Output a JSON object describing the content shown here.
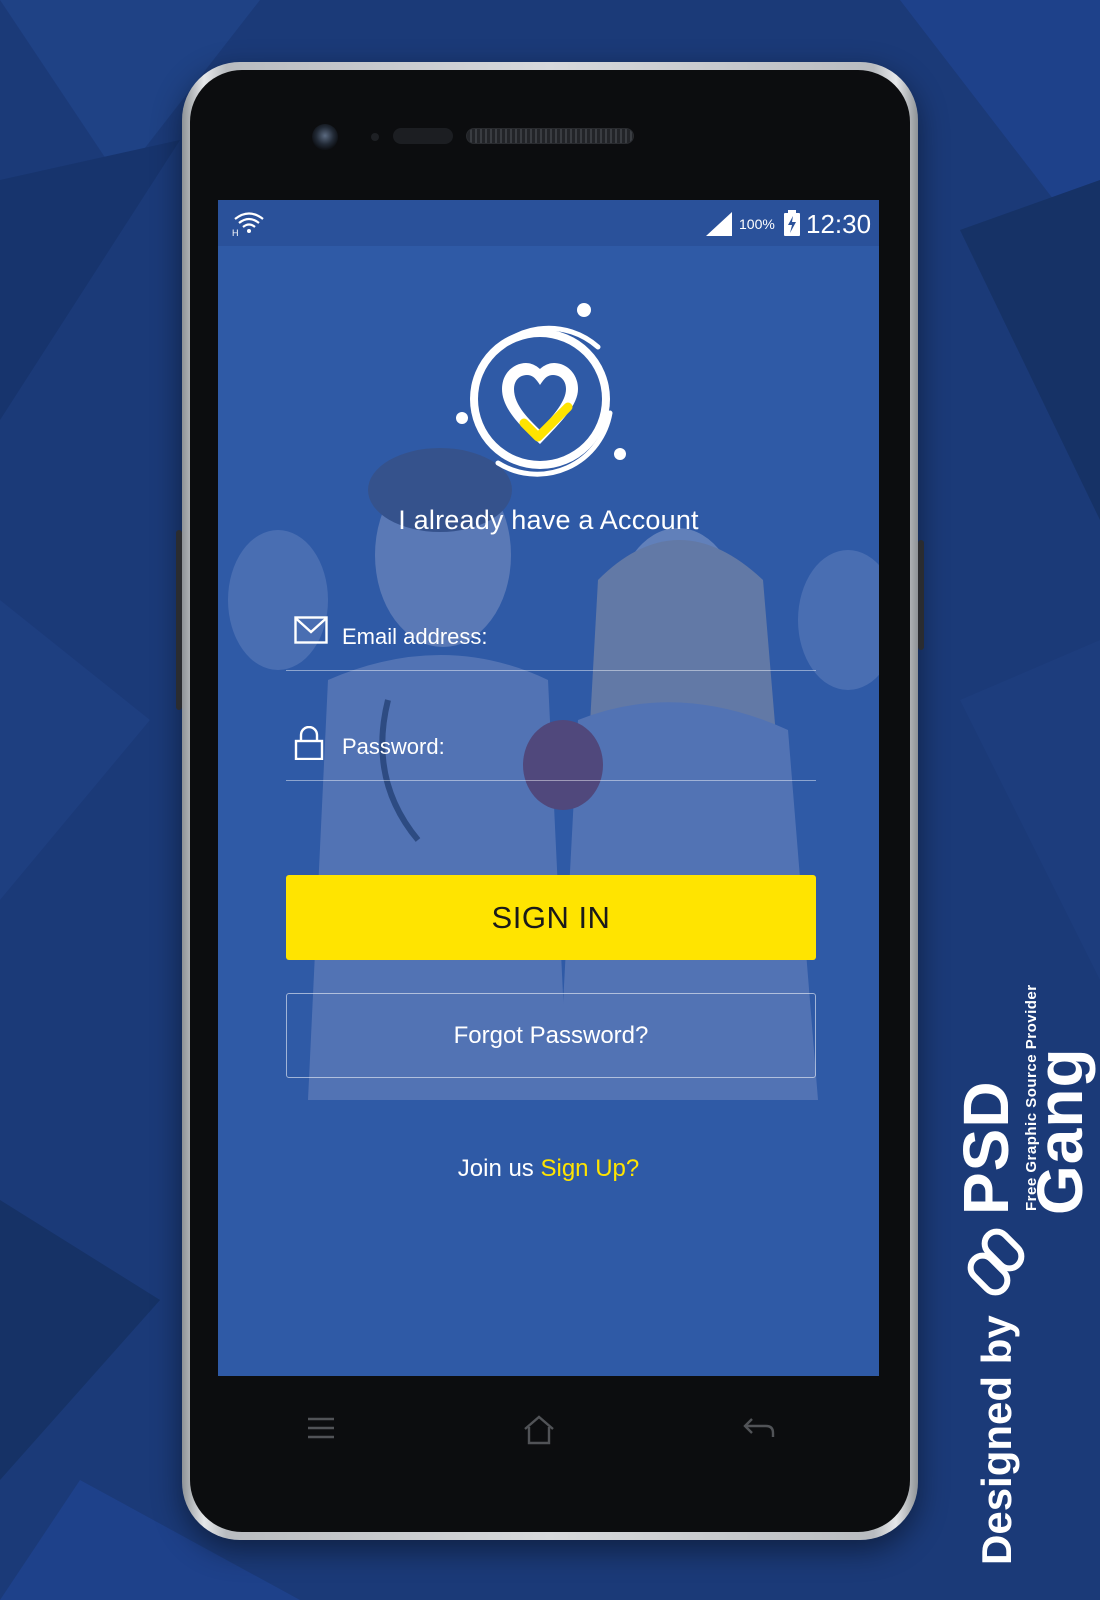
{
  "status_bar": {
    "battery_percent": "100%",
    "time": "12:30"
  },
  "login": {
    "headline": "I already have a Account",
    "email_placeholder": "Email address:",
    "password_placeholder": "Password:",
    "sign_in_label": "SIGN IN",
    "forgot_label": "Forgot Password?",
    "join_text": "Join us",
    "sign_up_label": "Sign Up?"
  },
  "icons": {
    "wifi": "wifi-icon",
    "signal": "signal-icon",
    "battery": "battery-charging-icon",
    "logo": "heart-check-logo",
    "email": "envelope-icon",
    "password": "lock-icon",
    "menu": "menu-icon",
    "home": "home-icon",
    "back": "back-icon"
  },
  "watermark": {
    "designed_by": "Designed by",
    "brand": "PSD Gang",
    "tagline": "Free Graphic Source Provider"
  },
  "colors": {
    "background": "#1b3a78",
    "screen": "#2f5aa6",
    "accent_yellow": "#ffe400",
    "text_white": "#ffffff"
  }
}
